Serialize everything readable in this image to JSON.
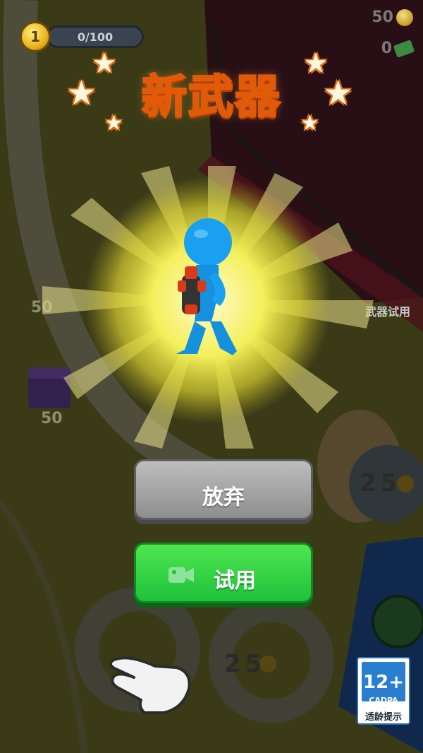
{
  "hud": {
    "level": "1",
    "level_progress": "0/100",
    "coins": "50",
    "cash": "0"
  },
  "popup": {
    "title": "新武器",
    "give_up_label": "放弃",
    "try_label": "试用"
  },
  "world": {
    "weapon_trial_label": "武器试用",
    "price_left_1": "50",
    "price_left_2": "50",
    "price_right": "25",
    "price_bottom": "25"
  },
  "age_rating": {
    "age": "12+",
    "org": "CADPA",
    "hint": "适龄提示"
  },
  "colors": {
    "title_fill": "#fff4c0",
    "title_stroke": "#e05a0a",
    "try_button": "#1ec23c",
    "give_up_button": "#9e9e9e",
    "character": "#1aa0f0"
  }
}
